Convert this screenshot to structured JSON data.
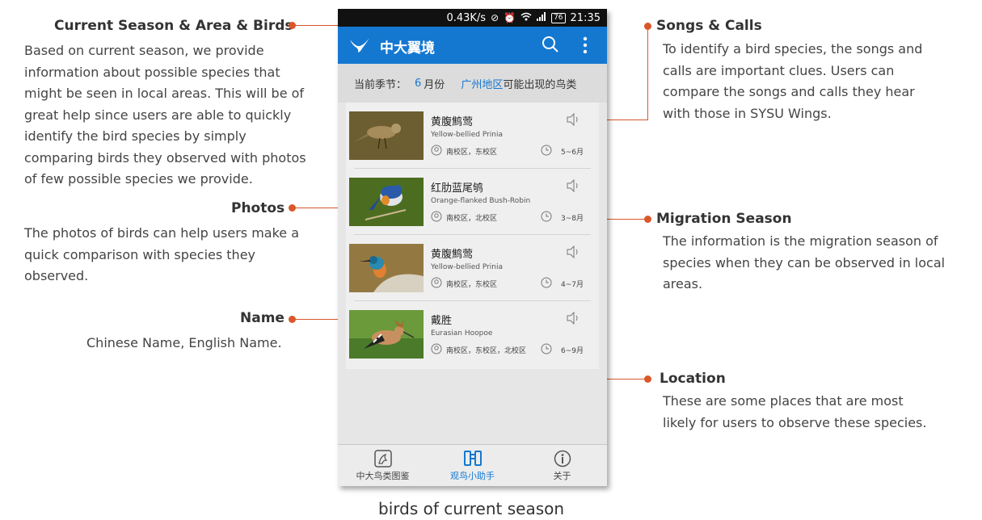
{
  "annotations": {
    "current_season": {
      "title": "Current Season & Area & Birds",
      "lines": [
        "Based on current season, we provide",
        "information about possible species that",
        "might be seen in local areas. This will be of",
        "great help since users are  able to quickly",
        "identify the bird species by simply",
        "comparing birds they observed  with photos",
        "of few possible species we provide."
      ]
    },
    "photos": {
      "title": "Photos",
      "lines": [
        "The photos of birds can help users make a",
        "quick comparison with species they",
        "observed."
      ]
    },
    "name": {
      "title": "Name",
      "lines": [
        "Chinese Name, English Name."
      ]
    },
    "songs": {
      "title": "Songs & Calls",
      "lines": [
        "To identify a bird species, the songs and",
        "calls are important clues. Users can",
        "compare the songs and calls they hear",
        "with those in SYSU Wings."
      ]
    },
    "migration": {
      "title": "Migration Season",
      "lines": [
        "The information is the migration season of",
        "species when they can be observed in local",
        "areas."
      ]
    },
    "location": {
      "title": "Location",
      "lines": [
        "These are some places that are most",
        "likely for users to observe these species."
      ]
    }
  },
  "phone": {
    "status": {
      "speed": "0.43K/s",
      "battery": "76",
      "time": "21:35"
    },
    "app_title": "中大翼境",
    "season_bar": {
      "prefix": "当前季节：",
      "month": "6",
      "month_suffix": "月份",
      "area": "广州地区",
      "suffix": "可能出现的鸟类"
    },
    "birds": [
      {
        "cn": "黄腹鹪莺",
        "en": "Yellow-bellied Prinia",
        "locations": "南校区，东校区",
        "months": "5~6月"
      },
      {
        "cn": "红肋蓝尾鸲",
        "en": "Orange-flanked Bush-Robin",
        "locations": "南校区，北校区",
        "months": "3~8月"
      },
      {
        "cn": "黄腹鹪莺",
        "en": "Yellow-bellied Prinia",
        "locations": "南校区，东校区",
        "months": "4~7月"
      },
      {
        "cn": "戴胜",
        "en": "Eurasian Hoopoe",
        "locations": "南校区，东校区，北校区",
        "months": "6~9月"
      }
    ],
    "tabs": [
      {
        "label": "中大鸟类图鉴"
      },
      {
        "label": "观鸟小助手"
      },
      {
        "label": "关于"
      }
    ]
  },
  "caption": "birds of current season",
  "colors": {
    "accent": "#1478d1",
    "annotation": "#d9572a"
  }
}
